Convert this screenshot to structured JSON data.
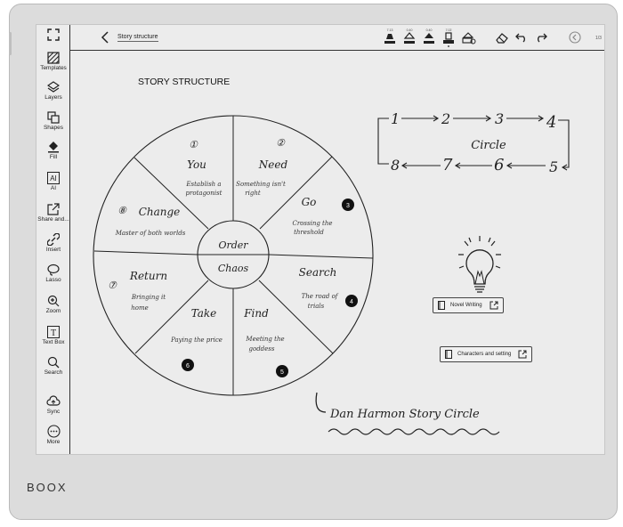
{
  "device": {
    "brand": "BOOX"
  },
  "toolbar": {
    "items": [
      {
        "label": "Templates",
        "icon": "templates-icon"
      },
      {
        "label": "Layers",
        "icon": "layers-icon"
      },
      {
        "label": "Shapes",
        "icon": "shapes-icon"
      },
      {
        "label": "Fill",
        "icon": "fill-icon"
      },
      {
        "label": "AI",
        "icon": "ai-icon"
      },
      {
        "label": "Share and...",
        "icon": "share-icon"
      },
      {
        "label": "Insert",
        "icon": "insert-icon"
      },
      {
        "label": "Lasso",
        "icon": "lasso-icon"
      },
      {
        "label": "Zoom",
        "icon": "zoom-icon"
      },
      {
        "label": "Text Box",
        "icon": "text-box-icon"
      },
      {
        "label": "Search",
        "icon": "search-icon"
      },
      {
        "label": "Sync",
        "icon": "sync-icon"
      },
      {
        "label": "More",
        "icon": "more-icon"
      }
    ],
    "ai_glyph": "AI",
    "textbox_glyph": "T"
  },
  "topbar": {
    "doc_title": "Story structure",
    "page_indicator": "1/3",
    "pen_sizes": [
      "7.13",
      "0.40",
      "0.40",
      "7.02"
    ]
  },
  "canvas": {
    "heading": "STORY STRUCTURE",
    "circle_center": {
      "top": "Order",
      "bottom": "Chaos"
    },
    "segments": [
      {
        "num": "①",
        "title": "You",
        "desc1": "Establish a",
        "desc2": "protagonist"
      },
      {
        "num": "②",
        "title": "Need",
        "desc1": "Something isn't",
        "desc2": "right"
      },
      {
        "num": "3",
        "title": "Go",
        "desc1": "Crossing the",
        "desc2": "threshold"
      },
      {
        "num": "4",
        "title": "Search",
        "desc1": "The road of",
        "desc2": "trials"
      },
      {
        "num": "5",
        "title": "Find",
        "desc1": "Meeting the",
        "desc2": "goddess"
      },
      {
        "num": "6",
        "title": "Take",
        "desc1": "Paying the price",
        "desc2": ""
      },
      {
        "num": "⑦",
        "title": "Return",
        "desc1": "Bringing it",
        "desc2": "home"
      },
      {
        "num": "⑧",
        "title": "Change",
        "desc1": "Master of both worlds",
        "desc2": ""
      }
    ],
    "flow_nums": [
      "1",
      "2",
      "3",
      "4",
      "5",
      "6",
      "7",
      "8"
    ],
    "flow_label": "Circle",
    "links": [
      {
        "label": "Novel Writing"
      },
      {
        "label": "Characters and setting"
      }
    ],
    "signature": "Dan Harmon Story Circle"
  }
}
